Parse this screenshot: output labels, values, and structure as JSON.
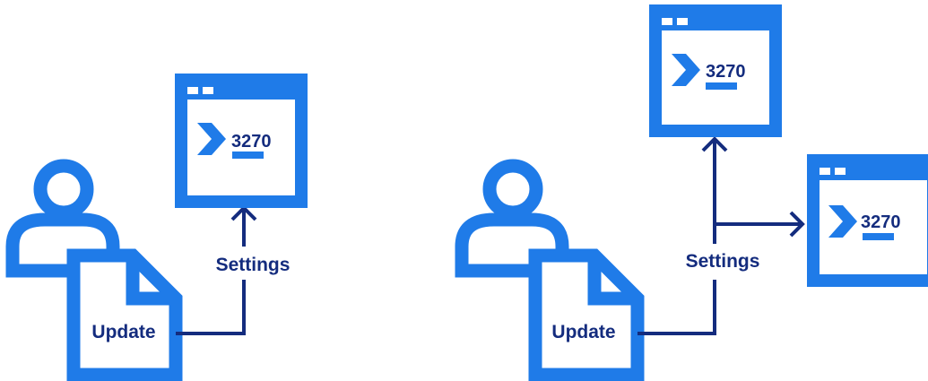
{
  "colors": {
    "primary_blue": "#1f7be8",
    "navy": "#142c7e",
    "background": "#ffffff"
  },
  "left_diagram": {
    "document_label": "Update",
    "connector_label": "Settings",
    "terminal": {
      "session_id": "3270",
      "icon": "terminal-prompt-icon"
    },
    "icons": [
      "user-icon",
      "document-icon",
      "arrow-up-icon"
    ]
  },
  "right_diagram": {
    "document_label": "Update",
    "connector_label": "Settings",
    "terminals": [
      {
        "session_id": "3270",
        "icon": "terminal-prompt-icon"
      },
      {
        "session_id": "3270",
        "icon": "terminal-prompt-icon"
      }
    ],
    "icons": [
      "user-icon",
      "document-icon",
      "arrow-up-icon",
      "arrow-right-icon"
    ]
  }
}
